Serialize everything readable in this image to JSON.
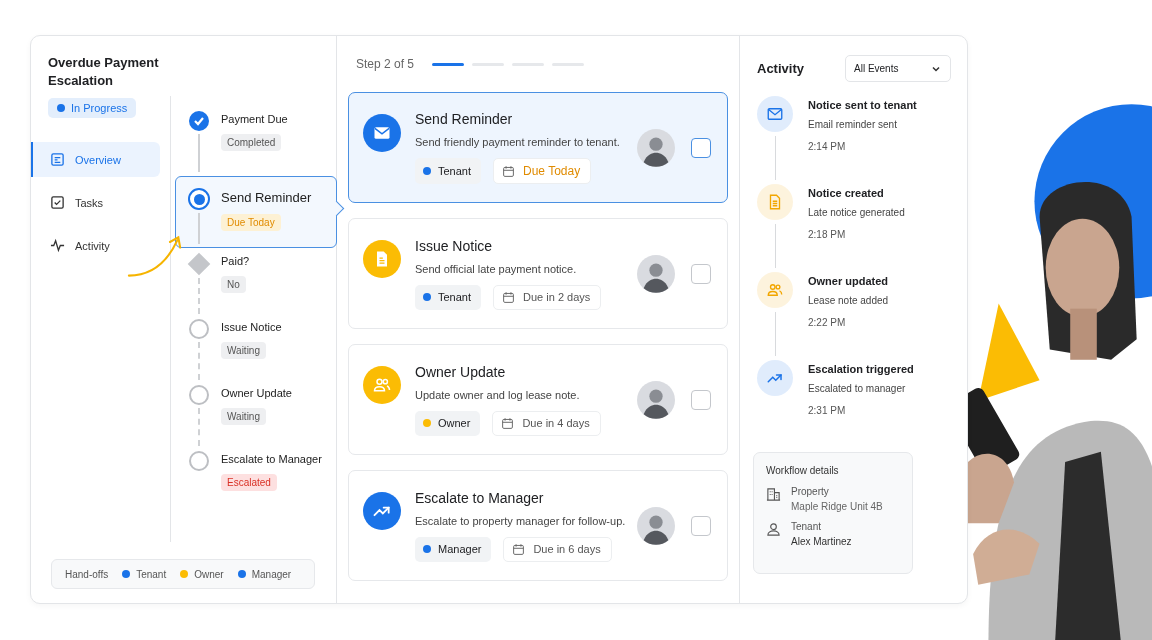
{
  "workflow": {
    "title": "Overdue Payment Escalation",
    "status": "In Progress"
  },
  "nav": [
    {
      "label": "Overview",
      "kind": "overview",
      "selected": true
    },
    {
      "label": "Tasks",
      "kind": "tasks",
      "selected": false
    },
    {
      "label": "Activity",
      "kind": "activity",
      "selected": false
    }
  ],
  "steps": [
    {
      "name": "Payment Due",
      "status": {
        "label": "Completed",
        "kind": "neutral"
      },
      "kind": "done",
      "selected": false
    },
    {
      "name": "Send Reminder",
      "status": {
        "label": "Due Today",
        "kind": "warning"
      },
      "kind": "current",
      "selected": true
    },
    {
      "name": "Paid?",
      "status": {
        "label": "No",
        "kind": "neutral"
      },
      "kind": "decision",
      "selected": false
    },
    {
      "name": "Issue Notice",
      "status": {
        "label": "Waiting",
        "kind": "neutral"
      },
      "kind": "pending",
      "selected": false
    },
    {
      "name": "Owner Update",
      "status": {
        "label": "Waiting",
        "kind": "neutral"
      },
      "kind": "pending",
      "selected": false
    },
    {
      "name": "Escalate to Manager",
      "status": {
        "label": "Escalated",
        "kind": "danger"
      },
      "kind": "pending",
      "selected": false
    }
  ],
  "legend": {
    "label": "Hand-offs",
    "items": [
      {
        "label": "Tenant",
        "color": "#1a73e8"
      },
      {
        "label": "Owner",
        "color": "#fbbc04"
      },
      {
        "label": "Manager",
        "color": "#1a73e8"
      }
    ]
  },
  "progress": {
    "label": "Step 2 of 5",
    "segments": [
      {
        "on": true
      },
      {
        "on": false
      },
      {
        "on": false
      },
      {
        "on": false
      }
    ]
  },
  "tasks": [
    {
      "title": "Send Reminder",
      "description": "Send friendly payment reminder to tenant.",
      "kind": "mail",
      "color": "#1a73e8",
      "assignee": {
        "label": "Tenant",
        "color": "#1a73e8"
      },
      "due": {
        "label": "Due Today",
        "urgent": true
      },
      "selected": true,
      "checked": false
    },
    {
      "title": "Issue Notice",
      "description": "Send official late payment notice.",
      "kind": "document",
      "color": "#fbbc04",
      "assignee": {
        "label": "Tenant",
        "color": "#1a73e8"
      },
      "due": {
        "label": "Due in 2 days",
        "urgent": false
      },
      "selected": false,
      "checked": false
    },
    {
      "title": "Owner Update",
      "description": "Update owner and log lease note.",
      "kind": "people",
      "color": "#fbbc04",
      "assignee": {
        "label": "Owner",
        "color": "#fbbc04"
      },
      "due": {
        "label": "Due in 4 days",
        "urgent": false
      },
      "selected": false,
      "checked": false
    },
    {
      "title": "Escalate to Manager",
      "description": "Escalate to property manager for follow-up.",
      "kind": "trend",
      "color": "#1a73e8",
      "assignee": {
        "label": "Manager",
        "color": "#1a73e8"
      },
      "due": {
        "label": "Due in 6 days",
        "urgent": false
      },
      "selected": false,
      "checked": false
    }
  ],
  "activity": {
    "title": "Activity",
    "filter": "All Events",
    "events": [
      {
        "kind": "mail",
        "color": "#1a73e8",
        "title": "Notice sent to tenant",
        "detail": "Email reminder sent",
        "time": "2:14 PM"
      },
      {
        "kind": "document",
        "color": "#f2a600",
        "title": "Notice created",
        "detail": "Late notice generated",
        "time": "2:18 PM"
      },
      {
        "kind": "people",
        "color": "#f2a600",
        "title": "Owner updated",
        "detail": "Lease note added",
        "time": "2:22 PM"
      },
      {
        "kind": "trend",
        "color": "#1a73e8",
        "title": "Escalation triggered",
        "detail": "Escalated to manager",
        "time": "2:31 PM"
      }
    ]
  },
  "details": {
    "title": "Workflow details",
    "items": [
      {
        "kind": "building",
        "label": "Property",
        "value": "Maple Ridge Unit 4B"
      },
      {
        "kind": "person",
        "label": "Tenant",
        "value": "Alex Martinez"
      }
    ]
  }
}
